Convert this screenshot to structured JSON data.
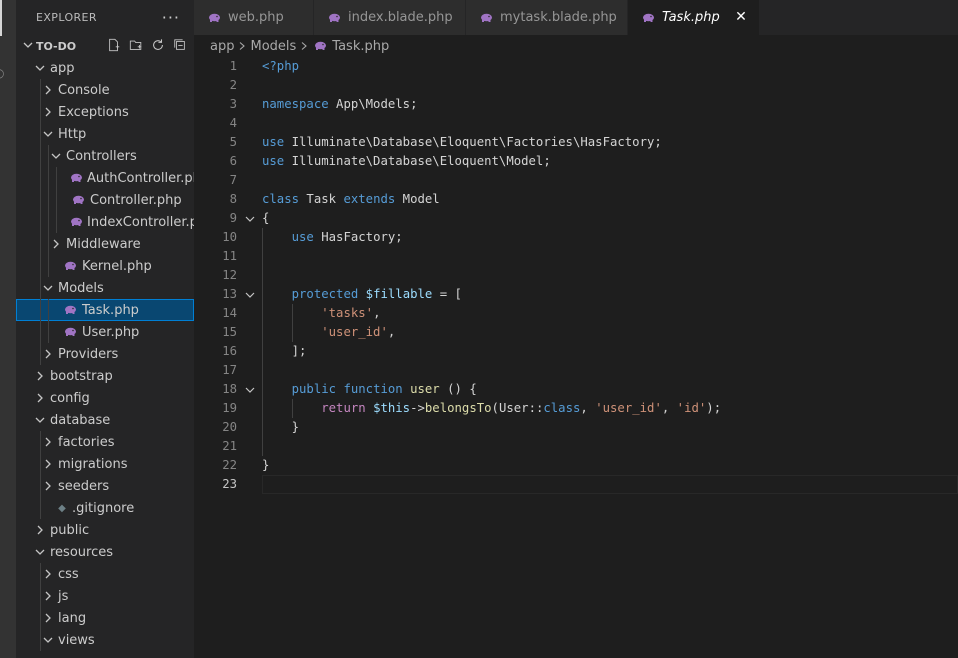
{
  "sidebar": {
    "title": "EXPLORER",
    "more": "···",
    "project": "TO-DO",
    "tree": [
      {
        "label": "app",
        "type": "folder",
        "open": true,
        "depth": 0
      },
      {
        "label": "Console",
        "type": "folder",
        "open": false,
        "depth": 1
      },
      {
        "label": "Exceptions",
        "type": "folder",
        "open": false,
        "depth": 1
      },
      {
        "label": "Http",
        "type": "folder",
        "open": true,
        "depth": 1
      },
      {
        "label": "Controllers",
        "type": "folder",
        "open": true,
        "depth": 2
      },
      {
        "label": "AuthController.php",
        "type": "php",
        "depth": 3
      },
      {
        "label": "Controller.php",
        "type": "php",
        "depth": 3
      },
      {
        "label": "IndexController.php",
        "type": "php",
        "depth": 3
      },
      {
        "label": "Middleware",
        "type": "folder",
        "open": false,
        "depth": 2
      },
      {
        "label": "Kernel.php",
        "type": "php",
        "depth": 2
      },
      {
        "label": "Models",
        "type": "folder",
        "open": true,
        "depth": 1
      },
      {
        "label": "Task.php",
        "type": "php",
        "depth": 2,
        "selected": true
      },
      {
        "label": "User.php",
        "type": "php",
        "depth": 2
      },
      {
        "label": "Providers",
        "type": "folder",
        "open": false,
        "depth": 1
      },
      {
        "label": "bootstrap",
        "type": "folder",
        "open": false,
        "depth": 0
      },
      {
        "label": "config",
        "type": "folder",
        "open": false,
        "depth": 0
      },
      {
        "label": "database",
        "type": "folder",
        "open": true,
        "depth": 0
      },
      {
        "label": "factories",
        "type": "folder",
        "open": false,
        "depth": 1
      },
      {
        "label": "migrations",
        "type": "folder",
        "open": false,
        "depth": 1
      },
      {
        "label": "seeders",
        "type": "folder",
        "open": false,
        "depth": 1
      },
      {
        "label": ".gitignore",
        "type": "git",
        "depth": 1
      },
      {
        "label": "public",
        "type": "folder",
        "open": false,
        "depth": 0
      },
      {
        "label": "resources",
        "type": "folder",
        "open": true,
        "depth": 0
      },
      {
        "label": "css",
        "type": "folder",
        "open": false,
        "depth": 1
      },
      {
        "label": "js",
        "type": "folder",
        "open": false,
        "depth": 1
      },
      {
        "label": "lang",
        "type": "folder",
        "open": false,
        "depth": 1
      },
      {
        "label": "views",
        "type": "folder",
        "open": true,
        "depth": 1
      }
    ]
  },
  "tabs": [
    {
      "label": "web.php",
      "active": false
    },
    {
      "label": "index.blade.php",
      "active": false
    },
    {
      "label": "mytask.blade.php",
      "active": false
    },
    {
      "label": "Task.php",
      "active": true
    }
  ],
  "breadcrumb": [
    "app",
    "Models",
    "Task.php"
  ],
  "editor": {
    "current_line": 23,
    "lines": [
      {
        "n": "1",
        "tokens": [
          [
            "<?php",
            "tag"
          ]
        ]
      },
      {
        "n": "2",
        "tokens": []
      },
      {
        "n": "3",
        "tokens": [
          [
            "namespace",
            "kw"
          ],
          [
            " App\\Models;",
            "ty"
          ]
        ]
      },
      {
        "n": "4",
        "tokens": []
      },
      {
        "n": "5",
        "tokens": [
          [
            "use",
            "kw"
          ],
          [
            " Illuminate\\Database\\Eloquent\\Factories\\HasFactory;",
            "ty"
          ]
        ]
      },
      {
        "n": "6",
        "tokens": [
          [
            "use",
            "kw"
          ],
          [
            " Illuminate\\Database\\Eloquent\\Model;",
            "ty"
          ]
        ]
      },
      {
        "n": "7",
        "tokens": []
      },
      {
        "n": "8",
        "tokens": [
          [
            "class",
            "kw"
          ],
          [
            " Task ",
            "ty"
          ],
          [
            "extends",
            "kw"
          ],
          [
            " Model",
            "ty"
          ]
        ]
      },
      {
        "n": "9",
        "tokens": [
          [
            "{",
            "ty"
          ]
        ],
        "fold": true
      },
      {
        "n": "10",
        "tokens": [
          [
            "    ",
            "ty"
          ],
          [
            "use",
            "kw"
          ],
          [
            " HasFactory;",
            "ty"
          ]
        ]
      },
      {
        "n": "11",
        "tokens": []
      },
      {
        "n": "12",
        "tokens": []
      },
      {
        "n": "13",
        "tokens": [
          [
            "    ",
            "ty"
          ],
          [
            "protected",
            "kw"
          ],
          [
            " ",
            "ty"
          ],
          [
            "$fillable",
            "var"
          ],
          [
            " = [",
            "ty"
          ]
        ],
        "fold": true
      },
      {
        "n": "14",
        "tokens": [
          [
            "        ",
            "ty"
          ],
          [
            "'tasks'",
            "str"
          ],
          [
            ",",
            "ty"
          ]
        ]
      },
      {
        "n": "15",
        "tokens": [
          [
            "        ",
            "ty"
          ],
          [
            "'user_id'",
            "str"
          ],
          [
            ",",
            "ty"
          ]
        ]
      },
      {
        "n": "16",
        "tokens": [
          [
            "    ];",
            "ty"
          ]
        ]
      },
      {
        "n": "17",
        "tokens": []
      },
      {
        "n": "18",
        "tokens": [
          [
            "    ",
            "ty"
          ],
          [
            "public",
            "kw"
          ],
          [
            " ",
            "ty"
          ],
          [
            "function",
            "kw"
          ],
          [
            " ",
            "ty"
          ],
          [
            "user",
            "fn"
          ],
          [
            " () {",
            "ty"
          ]
        ],
        "fold": true
      },
      {
        "n": "19",
        "tokens": [
          [
            "        ",
            "ty"
          ],
          [
            "return",
            "ctl"
          ],
          [
            " ",
            "ty"
          ],
          [
            "$this",
            "var"
          ],
          [
            "->",
            "ty"
          ],
          [
            "belongsTo",
            "fn"
          ],
          [
            "(User::",
            "ty"
          ],
          [
            "class",
            "kw"
          ],
          [
            ", ",
            "ty"
          ],
          [
            "'user_id'",
            "str"
          ],
          [
            ", ",
            "ty"
          ],
          [
            "'id'",
            "str"
          ],
          [
            ");",
            "ty"
          ]
        ]
      },
      {
        "n": "20",
        "tokens": [
          [
            "    }",
            "ty"
          ]
        ]
      },
      {
        "n": "21",
        "tokens": []
      },
      {
        "n": "22",
        "tokens": [
          [
            "}",
            "ty"
          ]
        ]
      },
      {
        "n": "23",
        "tokens": []
      }
    ]
  }
}
